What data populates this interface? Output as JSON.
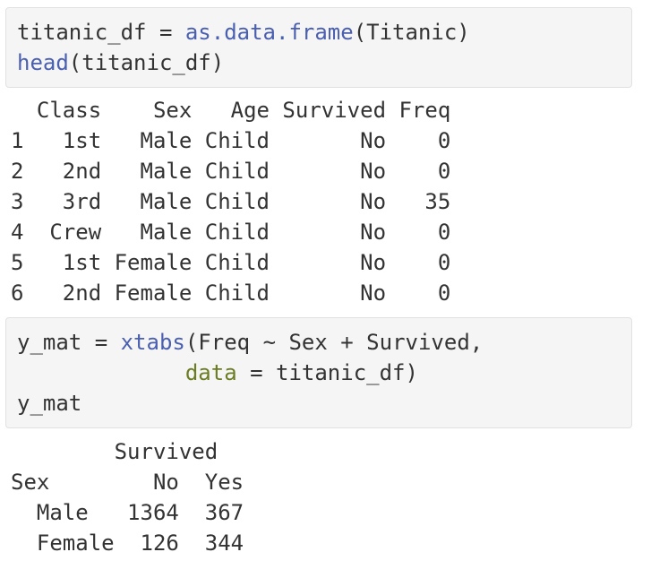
{
  "code_blocks": [
    {
      "lines": [
        [
          {
            "text": "titanic_df ",
            "role": "default"
          },
          {
            "text": "=",
            "role": "op"
          },
          {
            "text": " ",
            "role": "default"
          },
          {
            "text": "as.data.frame",
            "role": "func"
          },
          {
            "text": "(Titanic)",
            "role": "default"
          }
        ],
        [
          {
            "text": "head",
            "role": "func"
          },
          {
            "text": "(titanic_df)",
            "role": "default"
          }
        ]
      ]
    },
    {
      "lines": [
        [
          {
            "text": "y_mat ",
            "role": "default"
          },
          {
            "text": "=",
            "role": "op"
          },
          {
            "text": " ",
            "role": "default"
          },
          {
            "text": "xtabs",
            "role": "func"
          },
          {
            "text": "(Freq ",
            "role": "default"
          },
          {
            "text": "~",
            "role": "op"
          },
          {
            "text": " Sex ",
            "role": "default"
          },
          {
            "text": "+",
            "role": "op"
          },
          {
            "text": " Survived,",
            "role": "default"
          }
        ],
        [
          {
            "text": "             ",
            "role": "default"
          },
          {
            "text": "data",
            "role": "arg"
          },
          {
            "text": " ",
            "role": "default"
          },
          {
            "text": "=",
            "role": "op"
          },
          {
            "text": " titanic_df)",
            "role": "default"
          }
        ],
        [
          {
            "text": "y_mat",
            "role": "default"
          }
        ]
      ]
    }
  ],
  "outputs": [
    {
      "lines": [
        "  Class    Sex   Age Survived Freq",
        "1   1st   Male Child       No    0",
        "2   2nd   Male Child       No    0",
        "3   3rd   Male Child       No   35",
        "4  Crew   Male Child       No    0",
        "5   1st Female Child       No    0",
        "6   2nd Female Child       No    0"
      ]
    },
    {
      "lines": [
        "        Survived",
        "Sex        No  Yes",
        "  Male   1364  367",
        "  Female  126  344"
      ]
    }
  ],
  "colors": {
    "code_background": "#f5f5f5",
    "function": "#4a5fb0",
    "argument": "#6b7d23",
    "text": "#333333"
  }
}
